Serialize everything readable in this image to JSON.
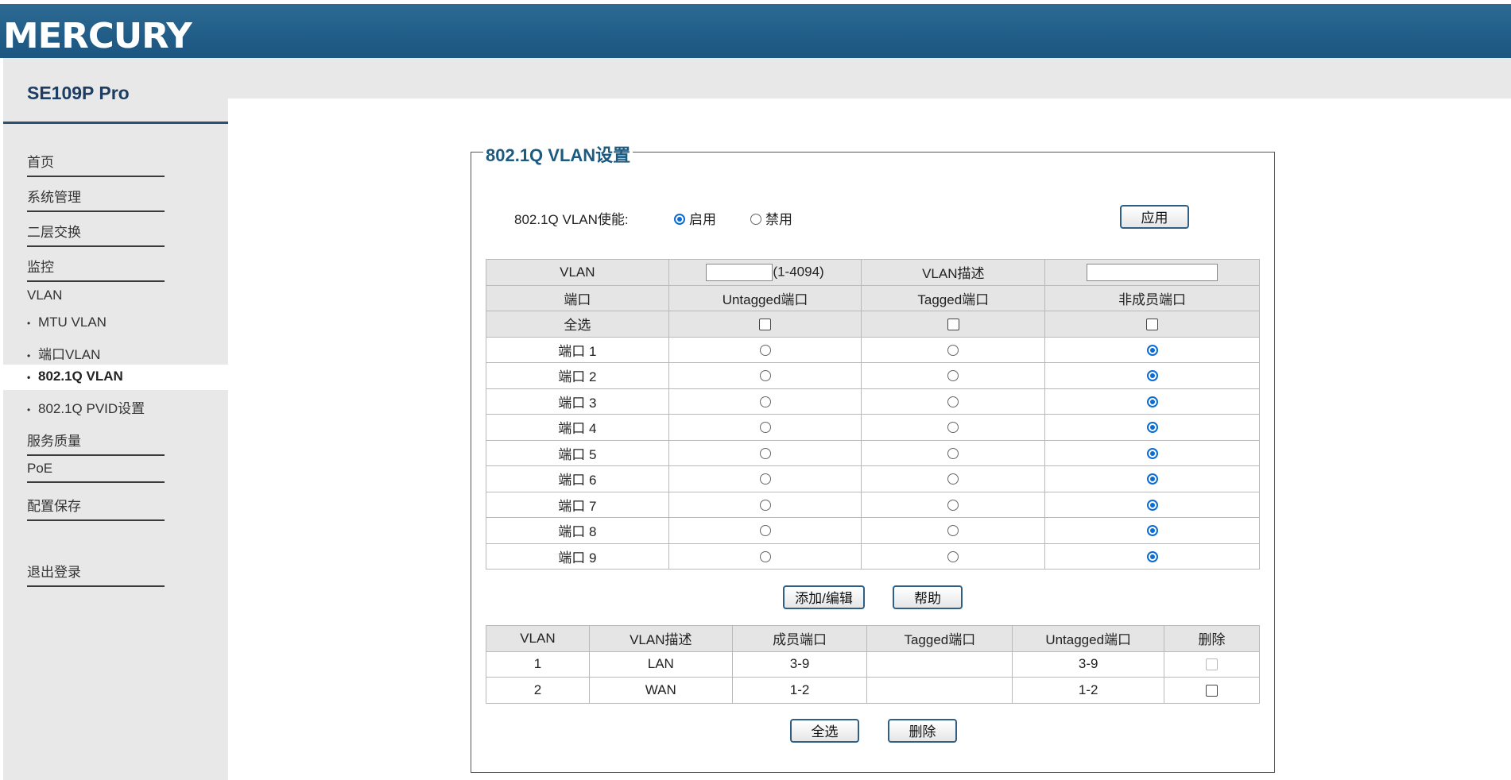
{
  "header": {
    "logo": "MERCURY"
  },
  "sidebar": {
    "model": "SE109P Pro",
    "items": [
      {
        "label": "首页"
      },
      {
        "label": "系统管理"
      },
      {
        "label": "二层交换"
      },
      {
        "label": "监控"
      },
      {
        "label": "VLAN"
      },
      {
        "label": "服务质量"
      },
      {
        "label": "PoE"
      },
      {
        "label": "配置保存"
      },
      {
        "label": "退出登录"
      }
    ],
    "vlan_sub": [
      {
        "label": "MTU VLAN"
      },
      {
        "label": "端口VLAN"
      },
      {
        "label": "802.1Q VLAN",
        "active": true
      },
      {
        "label": "802.1Q PVID设置"
      }
    ]
  },
  "panel": {
    "title": "802.1Q VLAN设置",
    "enable_label": "802.1Q VLAN使能:",
    "enable_on": "启用",
    "enable_off": "禁用",
    "enable_selected": "启用",
    "apply": "应用",
    "config": {
      "vlan_label": "VLAN",
      "vlan_value": "",
      "vlan_range": "(1-4094)",
      "desc_label": "VLAN描述",
      "desc_value": "",
      "col_port": "端口",
      "col_untagged": "Untagged端口",
      "col_tagged": "Tagged端口",
      "col_nonmember": "非成员端口",
      "select_all": "全选",
      "ports": [
        {
          "name": "端口 1",
          "selected": "nonmember"
        },
        {
          "name": "端口 2",
          "selected": "nonmember"
        },
        {
          "name": "端口 3",
          "selected": "nonmember"
        },
        {
          "name": "端口 4",
          "selected": "nonmember"
        },
        {
          "name": "端口 5",
          "selected": "nonmember"
        },
        {
          "name": "端口 6",
          "selected": "nonmember"
        },
        {
          "name": "端口 7",
          "selected": "nonmember"
        },
        {
          "name": "端口 8",
          "selected": "nonmember"
        },
        {
          "name": "端口 9",
          "selected": "nonmember"
        }
      ]
    },
    "add_edit": "添加/编辑",
    "help": "帮助",
    "list": {
      "headers": [
        "VLAN",
        "VLAN描述",
        "成员端口",
        "Tagged端口",
        "Untagged端口",
        "删除"
      ],
      "rows": [
        {
          "vlan": "1",
          "desc": "LAN",
          "members": "3-9",
          "tagged": "",
          "untagged": "3-9",
          "delete_disabled": true
        },
        {
          "vlan": "2",
          "desc": "WAN",
          "members": "1-2",
          "tagged": "",
          "untagged": "1-2",
          "delete_disabled": false
        }
      ]
    },
    "select_all_btn": "全选",
    "delete_btn": "删除"
  }
}
